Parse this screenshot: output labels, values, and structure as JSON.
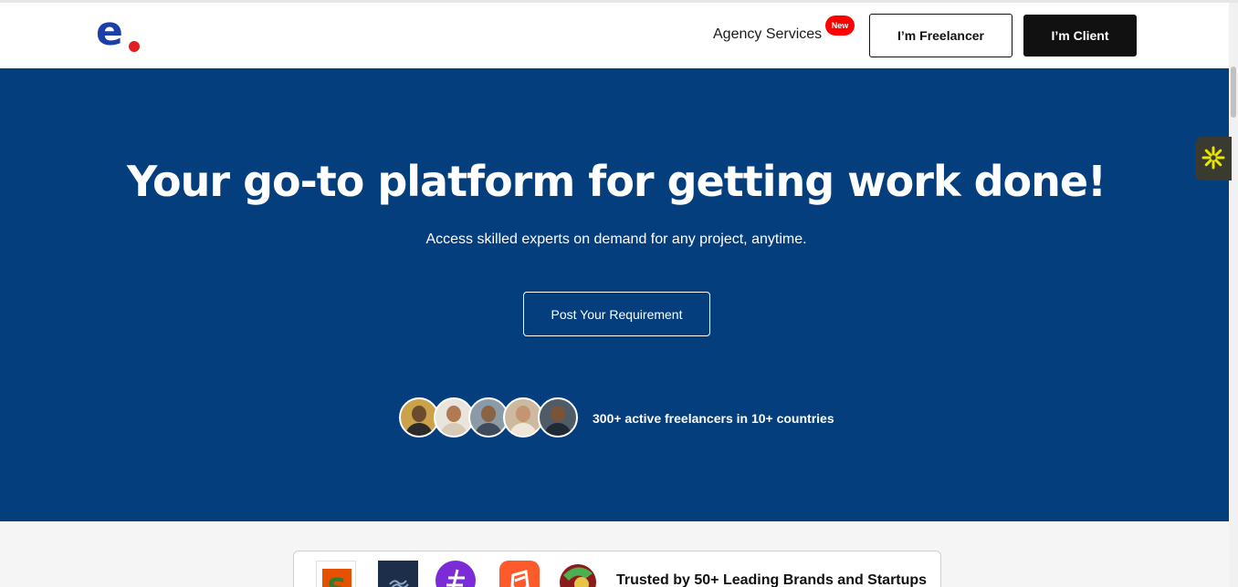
{
  "header": {
    "logo": {
      "letter": "e",
      "letter_color": "#1a3fa8",
      "dot_color": "#e02020"
    },
    "nav": {
      "agency_label": "Agency Services",
      "new_badge": "New",
      "new_badge_color": "#ff0000"
    },
    "freelancer_button": "I’m Freelancer",
    "client_button": "I’m Client"
  },
  "hero": {
    "background_color": "#053e7d",
    "title": "Your go-to platform for getting work done!",
    "subtitle": "Access skilled experts on demand for any project, anytime.",
    "cta_button": "Post Your Requirement",
    "stat_text": "300+ active freelancers in 10+ countries",
    "avatars": [
      {
        "icon": "freelancer-avatar-icon",
        "bg": "#c9a24a",
        "skin": "#6b4a2e",
        "shirt": "#2b2b2b"
      },
      {
        "icon": "freelancer-avatar-icon",
        "bg": "#e9e4dc",
        "skin": "#b07a55",
        "shirt": "#d6c9b5"
      },
      {
        "icon": "freelancer-avatar-icon",
        "bg": "#8a9aa6",
        "skin": "#8a6244",
        "shirt": "#3d4b5a"
      },
      {
        "icon": "freelancer-avatar-icon",
        "bg": "#cdb9a0",
        "skin": "#c49572",
        "shirt": "#efe6da"
      },
      {
        "icon": "freelancer-avatar-icon",
        "bg": "#4f5b66",
        "skin": "#7a5438",
        "shirt": "#1e2a36"
      }
    ]
  },
  "brands": {
    "text": "Trusted by 50+ Leading Brands and Startups",
    "logos": [
      {
        "icon": "brand-logo-s-icon",
        "bg": "#ffffff",
        "fg": "#2f7d32",
        "accent": "#e65100"
      },
      {
        "icon": "brand-logo-wave-icon",
        "bg": "#1c2e4a",
        "fg": "#8fa8c8"
      },
      {
        "icon": "brand-logo-hash-icon",
        "bg": "#7b2cd6",
        "fg": "#ffffff"
      },
      {
        "icon": "brand-logo-shield-icon",
        "bg": "#ff5a2c",
        "fg": "#ffffff"
      },
      {
        "icon": "brand-logo-globe-icon",
        "bg": "#ffffff",
        "fg": "#8a1c1c",
        "accent": "#4caf50"
      }
    ]
  },
  "side_widget": {
    "icon": "asterisk-widget-icon",
    "color": "#e6e600"
  }
}
